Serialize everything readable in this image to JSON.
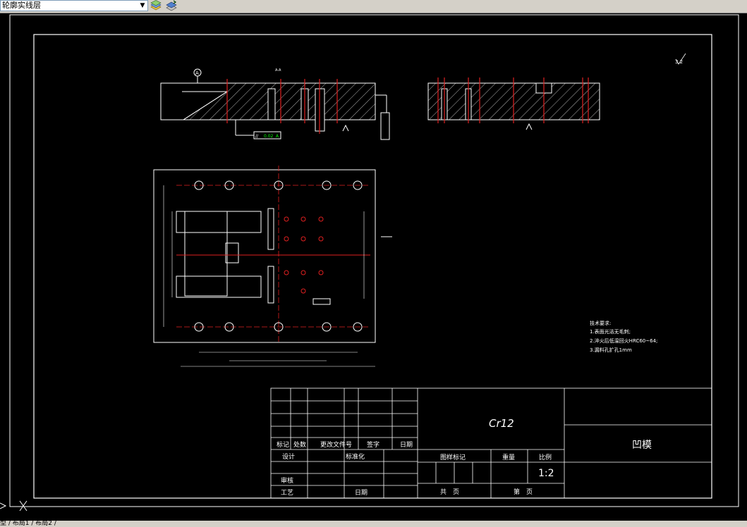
{
  "toolbar": {
    "layer_value": "轮廓实线层",
    "layer_icon": "layer-states-icon",
    "layer_icon2": "layer-previous-icon"
  },
  "drawing": {
    "section_label": "A-A",
    "roughness_note": "3.2",
    "material": "Cr12",
    "part_name": "凹模",
    "scale_value": "1:2",
    "tolerance_frame": {
      "symbol": "//",
      "value": "0.02",
      "datum": "A"
    },
    "datum_label": "A",
    "tech_requirements": {
      "title": "技术要求:",
      "items": [
        "1.表面光洁无毛刺;",
        "2.淬火后低温回火HRC60~64;",
        "3.漏料孔扩孔1mm"
      ]
    },
    "title_block": {
      "mark": "标记",
      "count": "处数",
      "change_doc": "更改文件号",
      "signature": "签字",
      "date": "日期",
      "designer": "设计",
      "standardization": "标准化",
      "review": "审核",
      "process": "工艺",
      "date2": "日期",
      "stage_mark": "图样标记",
      "weight": "重量",
      "scale": "比例",
      "total_sheets": "共　页",
      "sheet_no": "第　页"
    }
  },
  "statusbar": {
    "tabs": "型 / 布局1 / 布局2 /"
  },
  "colors": {
    "background": "#000000",
    "line": "#ffffff",
    "centerline": "#ff0000",
    "accent": "#00ff00"
  }
}
